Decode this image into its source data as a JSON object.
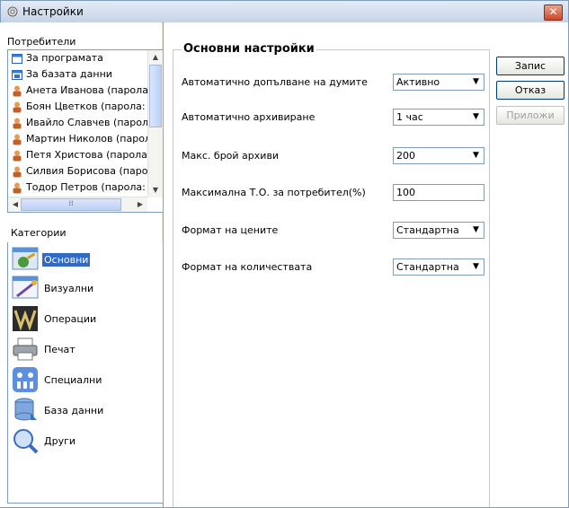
{
  "window": {
    "title": "Настройки",
    "close_label": "✕"
  },
  "users": {
    "label": "Потребители",
    "items": [
      {
        "label": "За програмата",
        "icon": "window-icon"
      },
      {
        "label": "За базата данни",
        "icon": "database-window-icon"
      },
      {
        "label": "Анета Иванова (парола",
        "icon": "user-icon"
      },
      {
        "label": "Боян Цветков (парола:",
        "icon": "user-icon"
      },
      {
        "label": "Ивайло Славчев (парол",
        "icon": "user-icon"
      },
      {
        "label": "Мартин Николов (парол",
        "icon": "user-icon"
      },
      {
        "label": "Петя Христова (парола",
        "icon": "user-icon"
      },
      {
        "label": "Силвия Борисова (паро",
        "icon": "user-icon"
      },
      {
        "label": "Тодор Петров (парола:",
        "icon": "user-icon"
      }
    ]
  },
  "categories": {
    "label": "Категории",
    "items": [
      {
        "label": "Основни",
        "selected": true
      },
      {
        "label": "Визуални",
        "selected": false
      },
      {
        "label": "Операции",
        "selected": false
      },
      {
        "label": "Печат",
        "selected": false
      },
      {
        "label": "Специални",
        "selected": false
      },
      {
        "label": "База данни",
        "selected": false
      },
      {
        "label": "Други",
        "selected": false
      }
    ]
  },
  "settings": {
    "title": "Основни настройки",
    "autocomplete": {
      "label": "Автоматично допълване на думите",
      "value": "Активно"
    },
    "autoarchive": {
      "label": "Автоматично архивиране",
      "value": "1 час"
    },
    "max_archives": {
      "label": "Макс. брой архиви",
      "value": "200"
    },
    "max_to": {
      "label": "Максимална Т.О. за потребител(%)",
      "value": "100"
    },
    "price_format": {
      "label": "Формат на цените",
      "value": "Стандартна"
    },
    "qty_format": {
      "label": "Формат на количествата",
      "value": "Стандартна"
    }
  },
  "buttons": {
    "save": "Запис",
    "cancel": "Отказ",
    "apply": "Приложи"
  },
  "colors": {
    "selection": "#316ac5",
    "accent_border": "#7f9db9"
  }
}
